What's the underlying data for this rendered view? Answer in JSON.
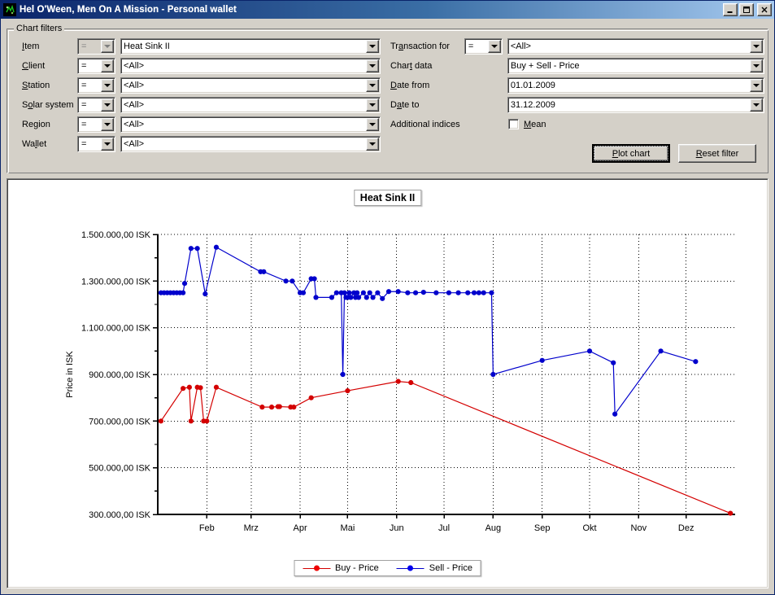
{
  "window": {
    "title": "Hel O'Ween, Men On A Mission - Personal wallet",
    "icon": "app-icon",
    "minimize_label": "Minimize",
    "maximize_label": "Maximize",
    "close_label": "Close"
  },
  "filters": {
    "group_label": "Chart filters",
    "left_rows": [
      {
        "label": "Item",
        "label_pre": "I",
        "label_post": "tem",
        "operator": "=",
        "value": "Heat Sink II",
        "operator_disabled": true
      },
      {
        "label": "Client",
        "label_pre": "C",
        "label_post": "lient",
        "operator": "=",
        "value": "<All>",
        "operator_disabled": false
      },
      {
        "label": "Station",
        "label_pre": "S",
        "label_post": "tation",
        "operator": "=",
        "value": "<All>",
        "operator_disabled": false
      },
      {
        "label": "Solar system",
        "label_pre": "S",
        "label_post": "olar system",
        "operator": "=",
        "value": "<All>",
        "operator_disabled": false
      },
      {
        "label": "Region",
        "label_pre": "R",
        "label_post": "egion",
        "operator": "=",
        "value": "<All>",
        "operator_disabled": false
      },
      {
        "label": "Wallet",
        "label_pre": "W",
        "label_post": "allet",
        "operator": "=",
        "value": "<All>",
        "operator_disabled": false
      }
    ],
    "transaction_for": {
      "label": "Transaction for",
      "operator": "=",
      "value": "<All>"
    },
    "chart_data_field": {
      "label": "Chart data",
      "value": "Buy + Sell - Price"
    },
    "date_from": {
      "label": "Date from",
      "value": "01.01.2009"
    },
    "date_to": {
      "label": "Date to",
      "value": "31.12.2009"
    },
    "additional_indices": {
      "label": "Additional indices",
      "checkbox_label": "Mean",
      "checked": false
    },
    "plot_button": "Plot chart",
    "reset_button": "Reset filter"
  },
  "chart_data": {
    "type": "line",
    "title": "Heat Sink II",
    "xlabel": "",
    "ylabel": "Price in ISK",
    "grid": true,
    "legend_position": "bottom",
    "xlim": [
      0,
      365
    ],
    "ylim": [
      300000,
      1500000
    ],
    "ytick_values": [
      300000,
      500000,
      700000,
      900000,
      1100000,
      1300000,
      1500000
    ],
    "ytick_labels": [
      "300.000,00 ISK",
      "500.000,00 ISK",
      "700.000,00 ISK",
      "900.000,00 ISK",
      "1.100.000,00 ISK",
      "1.300.000,00 ISK",
      "1.500.000,00 ISK"
    ],
    "xtick_labels": [
      "Feb",
      "Mrz",
      "Apr",
      "Mai",
      "Jun",
      "Jul",
      "Aug",
      "Sep",
      "Okt",
      "Nov",
      "Dez"
    ],
    "xtick_days": [
      31,
      59,
      90,
      120,
      151,
      181,
      212,
      243,
      273,
      304,
      334
    ],
    "minor_ytick_values": [
      400000,
      600000,
      800000,
      1000000,
      1200000,
      1400000
    ],
    "series": [
      {
        "name": "Buy - Price",
        "color": "#d40000",
        "points": [
          [
            2,
            700000
          ],
          [
            16,
            840000
          ],
          [
            20,
            845000
          ],
          [
            21,
            700000
          ],
          [
            25,
            845000
          ],
          [
            27,
            843000
          ],
          [
            29,
            700000
          ],
          [
            31,
            700000
          ],
          [
            37,
            845000
          ],
          [
            66,
            760000
          ],
          [
            72,
            760000
          ],
          [
            76,
            762000
          ],
          [
            77,
            762000
          ],
          [
            84,
            760000
          ],
          [
            86,
            760000
          ],
          [
            97,
            800000
          ],
          [
            120,
            830000
          ],
          [
            152,
            870000
          ],
          [
            160,
            865000
          ],
          [
            362,
            305000
          ]
        ]
      },
      {
        "name": "Sell - Price",
        "color": "#0000cc",
        "points": [
          [
            2,
            1250000
          ],
          [
            4,
            1250000
          ],
          [
            6,
            1250000
          ],
          [
            8,
            1250000
          ],
          [
            10,
            1250000
          ],
          [
            12,
            1250000
          ],
          [
            14,
            1250000
          ],
          [
            16,
            1250000
          ],
          [
            17,
            1290000
          ],
          [
            21,
            1440000
          ],
          [
            25,
            1440000
          ],
          [
            30,
            1245000
          ],
          [
            37,
            1445000
          ],
          [
            65,
            1340000
          ],
          [
            67,
            1340000
          ],
          [
            81,
            1300000
          ],
          [
            85,
            1300000
          ],
          [
            90,
            1250000
          ],
          [
            92,
            1250000
          ],
          [
            97,
            1310000
          ],
          [
            99,
            1310000
          ],
          [
            100,
            1230000
          ],
          [
            110,
            1230000
          ],
          [
            113,
            1250000
          ],
          [
            116,
            1250000
          ],
          [
            117,
            900000
          ],
          [
            118,
            1250000
          ],
          [
            119,
            1230000
          ],
          [
            120,
            1230000
          ],
          [
            121,
            1250000
          ],
          [
            122,
            1230000
          ],
          [
            124,
            1250000
          ],
          [
            125,
            1230000
          ],
          [
            126,
            1250000
          ],
          [
            127,
            1230000
          ],
          [
            130,
            1250000
          ],
          [
            132,
            1230000
          ],
          [
            134,
            1250000
          ],
          [
            136,
            1230000
          ],
          [
            139,
            1250000
          ],
          [
            142,
            1225000
          ],
          [
            146,
            1255000
          ],
          [
            152,
            1255000
          ],
          [
            158,
            1250000
          ],
          [
            163,
            1250000
          ],
          [
            168,
            1252000
          ],
          [
            176,
            1250000
          ],
          [
            184,
            1250000
          ],
          [
            190,
            1250000
          ],
          [
            196,
            1250000
          ],
          [
            200,
            1250000
          ],
          [
            203,
            1250000
          ],
          [
            206,
            1250000
          ],
          [
            211,
            1250000
          ],
          [
            212,
            900000
          ],
          [
            243,
            960000
          ],
          [
            273,
            1000000
          ],
          [
            288,
            950000
          ],
          [
            289,
            730000
          ],
          [
            318,
            1000000
          ],
          [
            340,
            955000
          ]
        ]
      }
    ]
  }
}
